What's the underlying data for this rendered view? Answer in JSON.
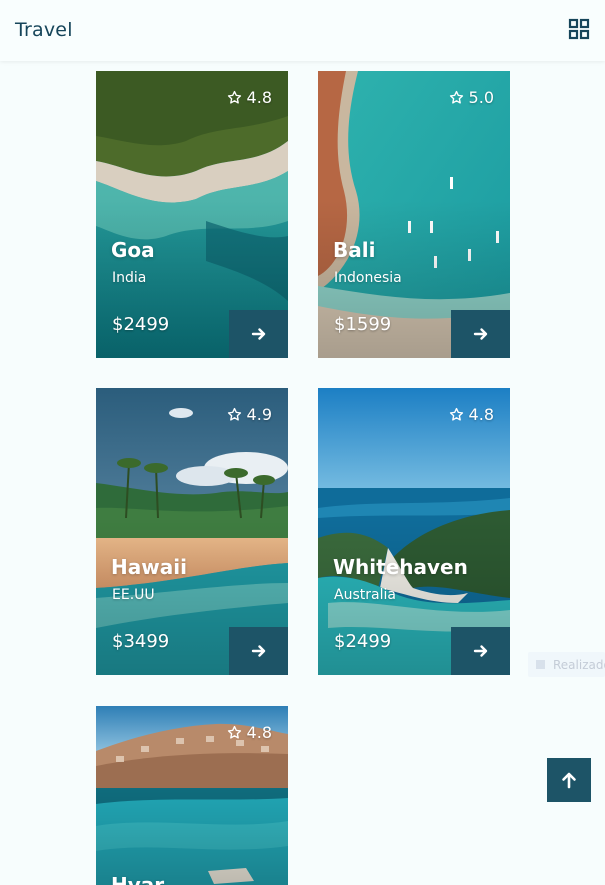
{
  "header": {
    "title": "Travel",
    "menu_icon": "grid-icon"
  },
  "destinations": [
    {
      "name": "Goa",
      "country": "India",
      "rating": "4.8",
      "price": "$2499"
    },
    {
      "name": "Bali",
      "country": "Indonesia",
      "rating": "5.0",
      "price": "$1599"
    },
    {
      "name": "Hawaii",
      "country": "EE.UU",
      "rating": "4.9",
      "price": "$3499"
    },
    {
      "name": "Whitehaven",
      "country": "Australia",
      "rating": "4.8",
      "price": "$2499"
    },
    {
      "name": "Hvar",
      "country": "",
      "rating": "4.8",
      "price": ""
    }
  ],
  "toast": {
    "label": "Realizado"
  },
  "colors": {
    "accent": "#1d5467",
    "title": "#16455a",
    "background": "#f7fdfd"
  },
  "icons": {
    "star": "star-outline-icon",
    "go": "arrow-right-icon",
    "scroll_top": "arrow-up-icon"
  }
}
